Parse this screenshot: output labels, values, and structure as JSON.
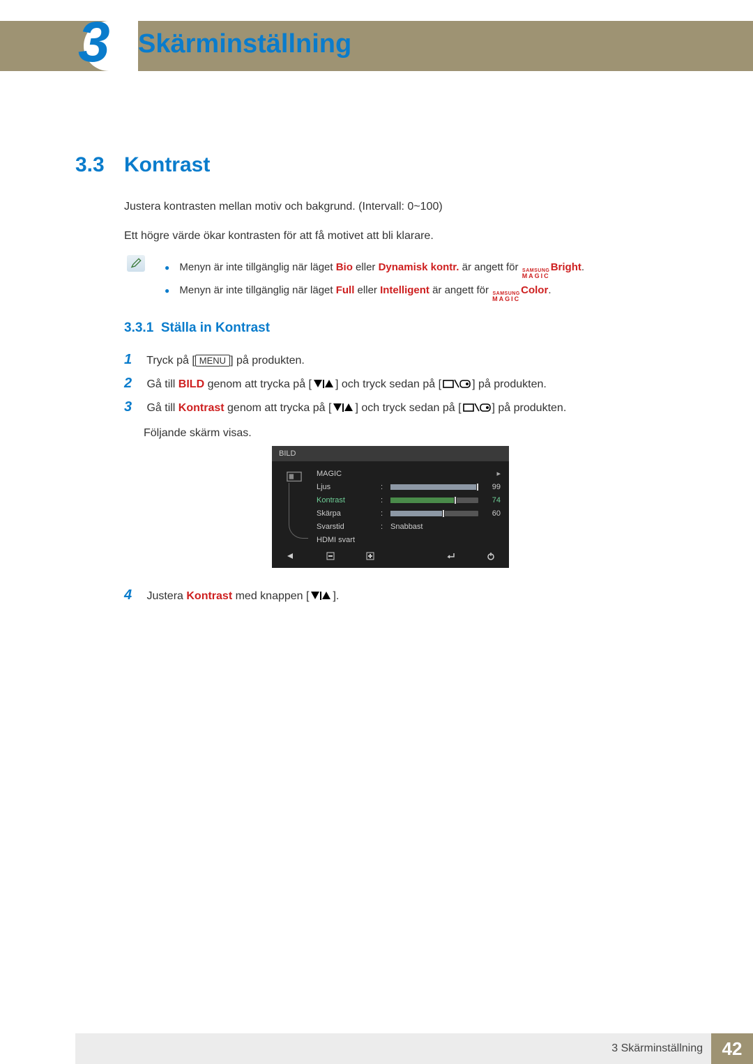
{
  "chapter": {
    "number": "3",
    "title": "Skärminställning"
  },
  "section": {
    "number": "3.3",
    "title": "Kontrast"
  },
  "body": {
    "p1": "Justera kontrasten mellan motiv och bakgrund. (Intervall: 0~100)",
    "p2": "Ett högre värde ökar kontrasten för att få motivet att bli klarare."
  },
  "notes": {
    "n1_a": "Menyn är inte tillgänglig när läget ",
    "n1_bio": "Bio",
    "n1_b": " eller ",
    "n1_dk": "Dynamisk kontr.",
    "n1_c": " är angett för ",
    "n1_suffix": "Bright",
    "n1_end": ".",
    "n2_a": "Menyn är inte tillgänglig när läget ",
    "n2_full": "Full",
    "n2_b": " eller ",
    "n2_int": "Intelligent",
    "n2_c": " är angett för ",
    "n2_suffix": "Color",
    "n2_end": ".",
    "magic_top": "SAMSUNG",
    "magic_bot": "MAGIC"
  },
  "subsection": {
    "number": "3.3.1",
    "title": "Ställa in Kontrast"
  },
  "steps": {
    "s1_a": "Tryck på [",
    "s1_key": "MENU",
    "s1_b": "] på produkten.",
    "s2_a": "Gå till ",
    "s2_bild": "BILD",
    "s2_b": " genom att trycka på [",
    "s2_c": "] och tryck sedan på [",
    "s2_d": "] på produkten.",
    "s3_a": "Gå till ",
    "s3_k": "Kontrast",
    "s3_b": " genom att trycka på [",
    "s3_c": "] och tryck sedan på [",
    "s3_d": "] på produkten.",
    "s3_e": "Följande skärm visas.",
    "s4_a": "Justera ",
    "s4_k": "Kontrast",
    "s4_b": " med knappen [",
    "s4_c": "]."
  },
  "osd": {
    "title": "BILD",
    "rows": {
      "magic": "MAGIC",
      "ljus": {
        "label": "Ljus",
        "value": "99",
        "pct": 99
      },
      "kontrast": {
        "label": "Kontrast",
        "value": "74",
        "pct": 74
      },
      "skarpa": {
        "label": "Skärpa",
        "value": "60",
        "pct": 60
      },
      "svarstid": {
        "label": "Svarstid",
        "value": "Snabbast"
      },
      "hdmi": {
        "label": "HDMI svart"
      }
    }
  },
  "footer": {
    "text": "3 Skärminställning",
    "page": "42"
  }
}
